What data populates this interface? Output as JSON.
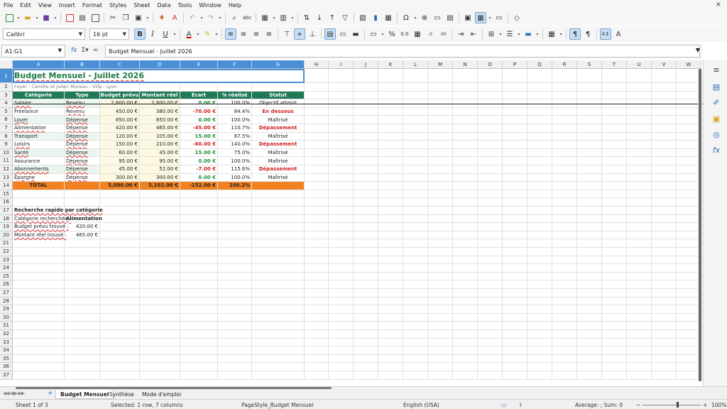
{
  "menu": {
    "items": [
      "File",
      "Edit",
      "View",
      "Insert",
      "Format",
      "Styles",
      "Sheet",
      "Data",
      "Tools",
      "Window",
      "Help"
    ],
    "close_glyph": "×"
  },
  "format_toolbar": {
    "font_name": "Calibri",
    "font_size": "16 pt"
  },
  "formula_bar": {
    "name_box": "A1:G1",
    "formula": "Budget Mensuel - Juillet 2026"
  },
  "columns": [
    "A",
    "B",
    "C",
    "D",
    "E",
    "F",
    "G",
    "H",
    "I",
    "J",
    "K",
    "L",
    "M",
    "N",
    "O",
    "P",
    "Q",
    "R",
    "S",
    "T",
    "U",
    "V",
    "W"
  ],
  "rows": [
    "1",
    "2",
    "3",
    "4",
    "5",
    "6",
    "7",
    "8",
    "9",
    "10",
    "11",
    "12",
    "13",
    "14",
    "15",
    "16",
    "17",
    "18",
    "19",
    "20",
    "21",
    "22",
    "23",
    "24",
    "25",
    "26",
    "27",
    "28",
    "29",
    "30",
    "31",
    "32",
    "33",
    "34",
    "35",
    "36",
    "37"
  ],
  "sheet": {
    "title": "Budget Mensuel - Juillet 2026",
    "subtitle": "Foyer : Camille et Julien Moreau - Ville : Lyon",
    "headers": [
      "Catégorie",
      "Type",
      "Budget prévu",
      "Montant réel",
      "Écart",
      "% réalisé",
      "Statut"
    ],
    "data": [
      [
        "Salaire",
        "Revenu",
        "2,600.00 €",
        "2,600.00 €",
        "0.00 €",
        "100.0%",
        "Objectif atteint"
      ],
      [
        "Freelance",
        "Revenu",
        "450.00 €",
        "380.00 €",
        "-70.00 €",
        "84.4%",
        "En dessous"
      ],
      [
        "Loyer",
        "Dépense",
        "850.00 €",
        "850.00 €",
        "0.00 €",
        "100.0%",
        "Maîtrisé"
      ],
      [
        "Alimentation",
        "Dépense",
        "420.00 €",
        "465.00 €",
        "-45.00 €",
        "110.7%",
        "Dépassement"
      ],
      [
        "Transport",
        "Dépense",
        "120.00 €",
        "105.00 €",
        "15.00 €",
        "87.5%",
        "Maîtrisé"
      ],
      [
        "Loisirs",
        "Dépense",
        "150.00 €",
        "210.00 €",
        "-60.00 €",
        "140.0%",
        "Dépassement"
      ],
      [
        "Santé",
        "Dépense",
        "60.00 €",
        "45.00 €",
        "15.00 €",
        "75.0%",
        "Maîtrisé"
      ],
      [
        "Assurance",
        "Dépense",
        "95.00 €",
        "95.00 €",
        "0.00 €",
        "100.0%",
        "Maîtrisé"
      ],
      [
        "Abonnements",
        "Dépense",
        "45.00 €",
        "52.00 €",
        "-7.00 €",
        "115.6%",
        "Dépassement"
      ],
      [
        "Épargne",
        "Dépense",
        "300.00 €",
        "300.00 €",
        "0.00 €",
        "100.0%",
        "Maîtrisé"
      ]
    ],
    "total": [
      "TOTAL",
      "",
      "5,090.00 €",
      "5,102.00 €",
      "-152.00 €",
      "100.2%",
      ""
    ],
    "lookup_title": "Recherche rapide par catégorie",
    "lookup_rows": [
      [
        "Catégorie recherchée :",
        "Alimentation"
      ],
      [
        "Budget prévu trouvé :",
        "420.00 €"
      ],
      [
        "Montant réel trouvé :",
        "465.00 €"
      ]
    ]
  },
  "tabs": {
    "items": [
      "Budget Mensuel",
      "Synthèse",
      "Mode d'emploi"
    ],
    "active": "Budget Mensuel",
    "add_glyph": "+"
  },
  "status": {
    "sheet": "Sheet 1 of 3",
    "selection": "Selected: 1 row, 7 columns",
    "page_style": "PageStyle_Budget Mensuel",
    "language": "English (USA)",
    "summary": "Average: ; Sum: 0",
    "zoom": "100%",
    "zoom_minus": "−",
    "zoom_plus": "+"
  },
  "colors": {
    "header_green": "#1f7a55",
    "total_orange": "#f08222",
    "selection_blue": "#4a8fd8",
    "positive": "#1f8f3a",
    "negative": "#cc2222"
  }
}
